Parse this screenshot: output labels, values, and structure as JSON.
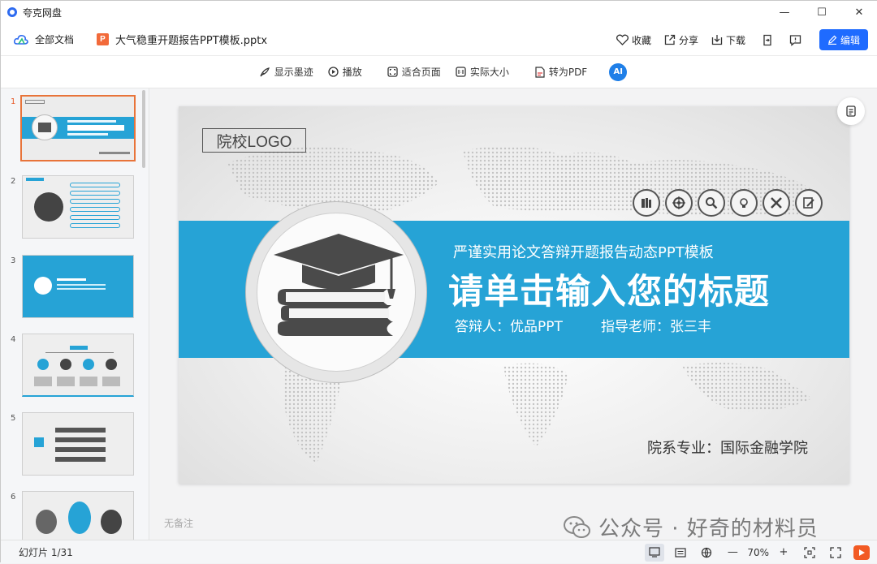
{
  "app": {
    "name": "夸克网盘"
  },
  "window_controls": {
    "minimize": "—",
    "maximize": "☐",
    "close": "✕"
  },
  "header": {
    "all_docs": "全部文档",
    "file_icon": "P",
    "file_name": "大气稳重开题报告PPT模板.pptx",
    "favorite": "收藏",
    "share": "分享",
    "download": "下载",
    "edit": "编辑"
  },
  "toolbar": {
    "show_ink": "显示墨迹",
    "play": "播放",
    "fit_page": "适合页面",
    "actual_size": "实际大小",
    "to_pdf": "转为PDF",
    "ai": "AI"
  },
  "sidebar": {
    "slides": [
      {
        "num": "1"
      },
      {
        "num": "2"
      },
      {
        "num": "3"
      },
      {
        "num": "4"
      },
      {
        "num": "5"
      },
      {
        "num": "6"
      }
    ]
  },
  "slide": {
    "logo": "院校LOGO",
    "subtitle": "严谨实用论文答辩开题报告动态PPT模板",
    "title": "请单击输入您的标题",
    "presenter": "答辩人：优品PPT",
    "advisor": "指导老师：张三丰",
    "department": "院系专业：国际金融学院"
  },
  "notes": "无备注",
  "watermark": "公众号 · 好奇的材料员",
  "status": {
    "slide_count": "幻灯片 1/31",
    "zoom_minus": "—",
    "zoom": "70%",
    "zoom_plus": "+"
  },
  "colors": {
    "accent": "#26a3d6",
    "edit_button": "#1f6bff",
    "active_thumb": "#e8743a"
  }
}
